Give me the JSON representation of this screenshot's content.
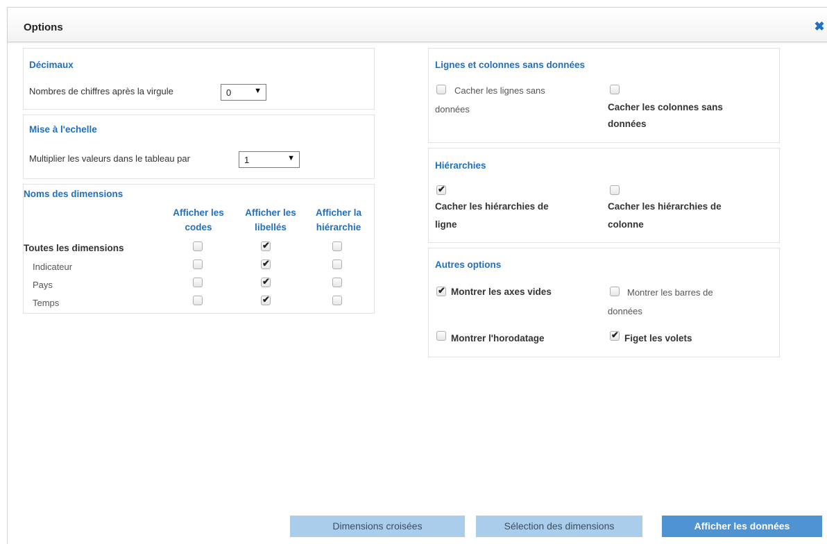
{
  "colors": {
    "accent": "#1f6fc3",
    "button_light": "#a9cdeb",
    "button_dark": "#4f93d3"
  },
  "dialog": {
    "title": "Options",
    "close_icon": "close-icon"
  },
  "decimals": {
    "title": "Décimaux",
    "label": "Nombres de chiffres après la virgule",
    "value": "0"
  },
  "scale": {
    "title": "Mise à l'echelle",
    "label": "Multiplier les valeurs dans le tableau par",
    "value": "1"
  },
  "dimension_names": {
    "title": "Noms des dimensions",
    "headers": [
      {
        "line1": "Afficher les",
        "line2": "codes"
      },
      {
        "line1": "Afficher les",
        "line2": "libellés"
      },
      {
        "line1": "Afficher la",
        "line2": "hiérarchie"
      }
    ],
    "rows": [
      {
        "label": "Toutes les dimensions",
        "codes": false,
        "labels": true,
        "hierarchy": false
      },
      {
        "label": "Indicateur",
        "codes": false,
        "labels": true,
        "hierarchy": false
      },
      {
        "label": "Pays",
        "codes": false,
        "labels": true,
        "hierarchy": false
      },
      {
        "label": "Temps",
        "codes": false,
        "labels": true,
        "hierarchy": false
      }
    ]
  },
  "empty_rows_cols": {
    "title": "Lignes et colonnes sans données",
    "hide_rows": {
      "line1": "Cacher les lignes sans",
      "line2": "données",
      "checked": false
    },
    "hide_cols": {
      "line1": "Cacher les colonnes sans",
      "line2": "données",
      "checked": false
    }
  },
  "hierarchies": {
    "title": "Hiérarchies",
    "row": {
      "line1": "Cacher les hiérarchies de",
      "line2": "ligne",
      "checked": true
    },
    "col": {
      "line1": "Cacher les hiérarchies de",
      "line2": "colonne",
      "checked": false
    }
  },
  "other_options": {
    "title": "Autres options",
    "empty_axes": {
      "label": "Montrer les axes vides",
      "checked": true
    },
    "data_bars": {
      "line1": "Montrer les barres de",
      "line2": "données",
      "checked": false
    },
    "timestamp": {
      "label": "Montrer l'horodatage",
      "checked": false
    },
    "freeze_panes": {
      "label": "Figet les volets",
      "checked": true
    }
  },
  "footer": {
    "cross_dimensions": "Dimensions croisées",
    "dimension_selection": "Sélection des dimensions",
    "show_data": "Afficher les données"
  }
}
